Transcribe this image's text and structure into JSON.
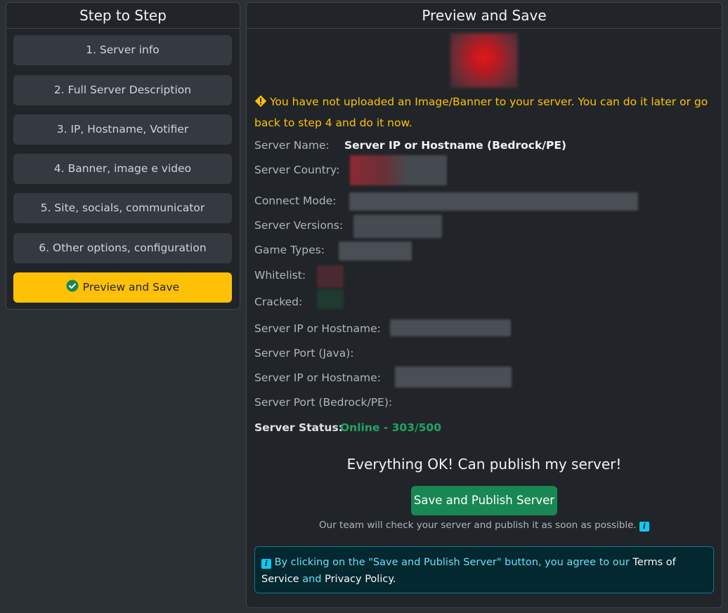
{
  "sidebar": {
    "title": "Step to Step",
    "steps": [
      {
        "label": "1. Server info"
      },
      {
        "label": "2. Full Server Description"
      },
      {
        "label": "3. IP, Hostname, Votifier"
      },
      {
        "label": "4. Banner, image e video"
      },
      {
        "label": "5. Site, socials, communicator"
      },
      {
        "label": "6. Other options, configuration"
      }
    ],
    "active_step": {
      "label": "Preview and Save",
      "icon": "check-circle-icon"
    }
  },
  "main": {
    "title": "Preview and Save",
    "warning": "You have not uploaded an Image/Banner to your server. You can do it later or go back to step 4 and do it now.",
    "fields": {
      "server_name_label": "Server Name:",
      "server_name_value": "Server IP or Hostname (Bedrock/PE)",
      "server_country_label": "Server Country:",
      "connect_mode_label": "Connect Mode:",
      "server_versions_label": "Server Versions:",
      "game_types_label": "Game Types:",
      "whitelist_label": "Whitelist:",
      "cracked_label": "Cracked:",
      "java_ip_label": "Server IP or Hostname:",
      "java_port_label": "Server Port (Java):",
      "bedrock_ip_label": "Server IP or Hostname:",
      "bedrock_port_label": "Server Port (Bedrock/PE):"
    },
    "status": {
      "label": "Server Status:",
      "value": "Online - 303/500"
    },
    "ok_message": "Everything OK! Can publish my server!",
    "publish_button": "Save and Publish Server",
    "team_note": "Our team will check your server and publish it as soon as possible.",
    "agreement": {
      "prefix": "By clicking on the \"Save and Publish Server\" button, you agree to our",
      "terms": "Terms of Service",
      "and": "and",
      "privacy": "Privacy Policy",
      "suffix": "."
    }
  },
  "colors": {
    "accent": "#ffc107",
    "success": "#198754",
    "info": "#0dcaf0",
    "card_bg": "#212529",
    "page_bg": "#2b3035"
  }
}
